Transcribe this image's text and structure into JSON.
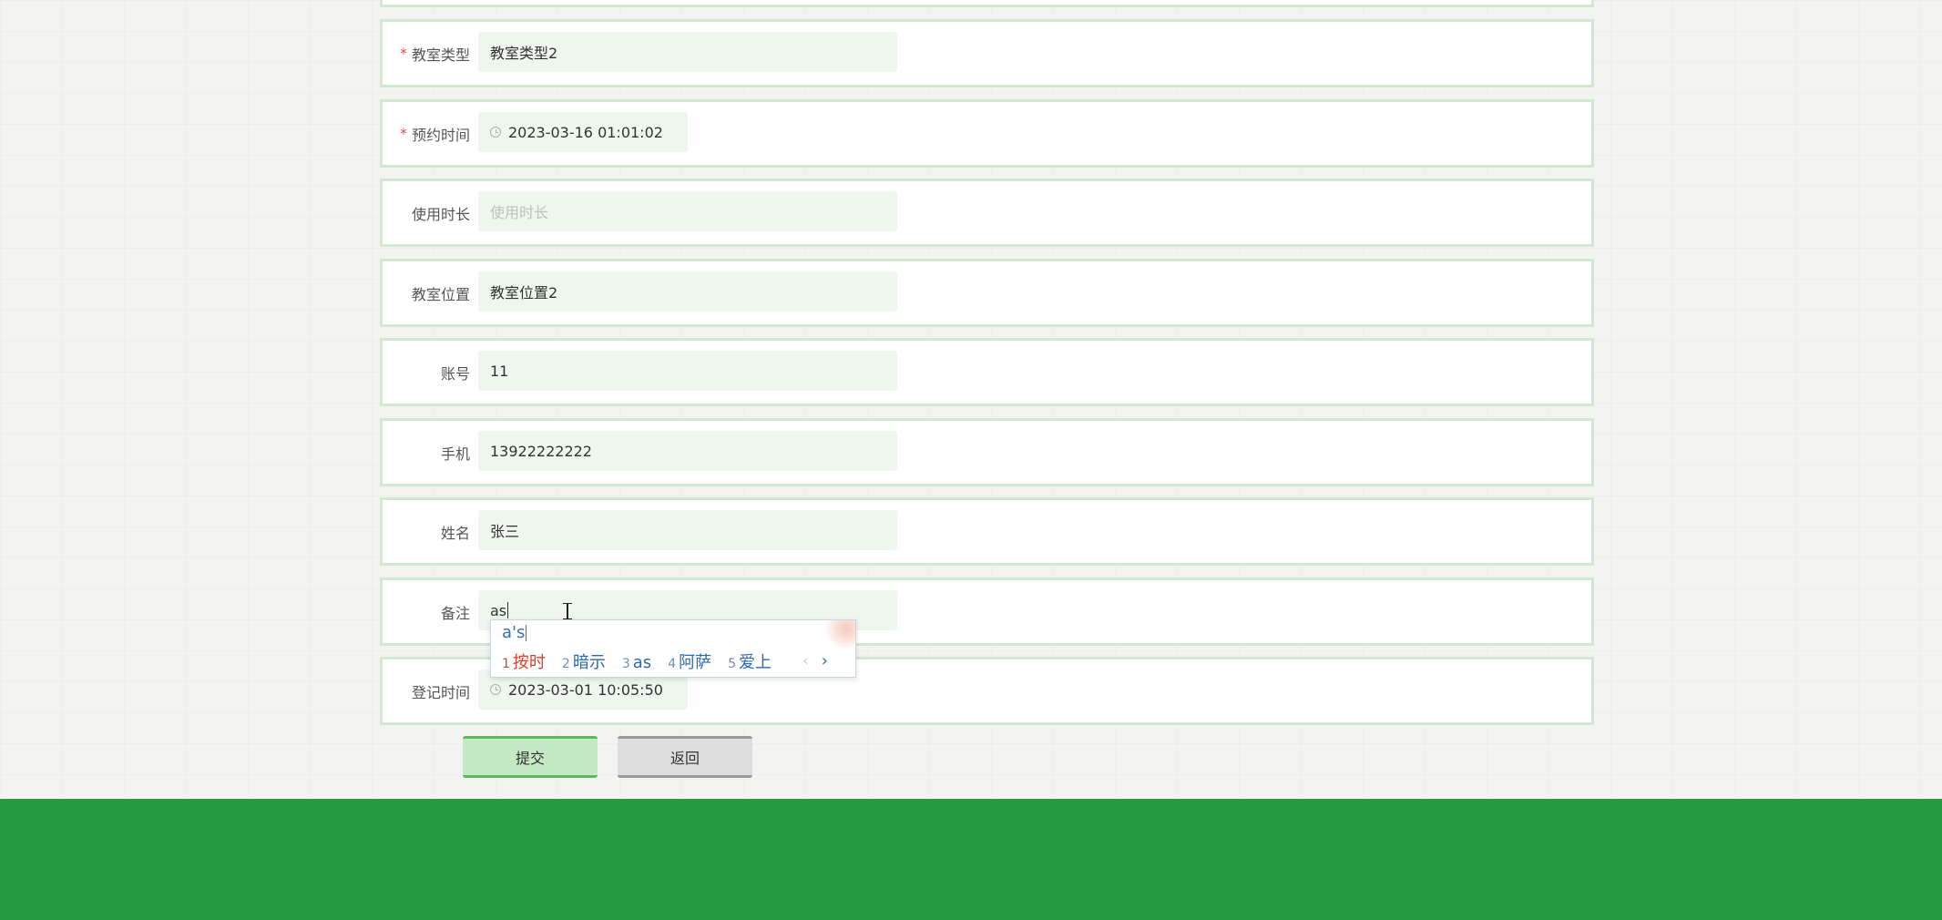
{
  "form": {
    "rows": [
      {
        "key": "classroom_type",
        "label": "教室类型",
        "required": true,
        "value": "教室类型2",
        "placeholder": "",
        "type": "text"
      },
      {
        "key": "booking_time",
        "label": "预约时间",
        "required": true,
        "value": "2023-03-16 01:01:02",
        "placeholder": "",
        "type": "date"
      },
      {
        "key": "duration",
        "label": "使用时长",
        "required": false,
        "value": "",
        "placeholder": "使用时长",
        "type": "text"
      },
      {
        "key": "location",
        "label": "教室位置",
        "required": false,
        "value": "教室位置2",
        "placeholder": "",
        "type": "text"
      },
      {
        "key": "account",
        "label": "账号",
        "required": false,
        "value": "11",
        "placeholder": "",
        "type": "text"
      },
      {
        "key": "phone",
        "label": "手机",
        "required": false,
        "value": "13922222222",
        "placeholder": "",
        "type": "text"
      },
      {
        "key": "name",
        "label": "姓名",
        "required": false,
        "value": "张三",
        "placeholder": "",
        "type": "text"
      },
      {
        "key": "remark",
        "label": "备注",
        "required": false,
        "value": "as",
        "placeholder": "",
        "type": "text"
      },
      {
        "key": "register_time",
        "label": "登记时间",
        "required": false,
        "value": "2023-03-01 10:05:50",
        "placeholder": "",
        "type": "date"
      }
    ],
    "required_mark": "*"
  },
  "buttons": {
    "submit": "提交",
    "back": "返回"
  },
  "ime": {
    "composition": "a's",
    "candidates": [
      {
        "num": "1",
        "text": "按时"
      },
      {
        "num": "2",
        "text": "暗示"
      },
      {
        "num": "3",
        "text": "as"
      },
      {
        "num": "4",
        "text": "阿萨"
      },
      {
        "num": "5",
        "text": "爱上"
      }
    ],
    "prev": "‹",
    "next": "›"
  },
  "colors": {
    "row_border": "#cfe8cf",
    "field_bg": "#eef6ee",
    "required": "#e54d42",
    "submit_bg": "#c5e8c5",
    "submit_accent": "#5cb85c",
    "back_bg": "#dddddd",
    "footer": "#279a3e"
  }
}
